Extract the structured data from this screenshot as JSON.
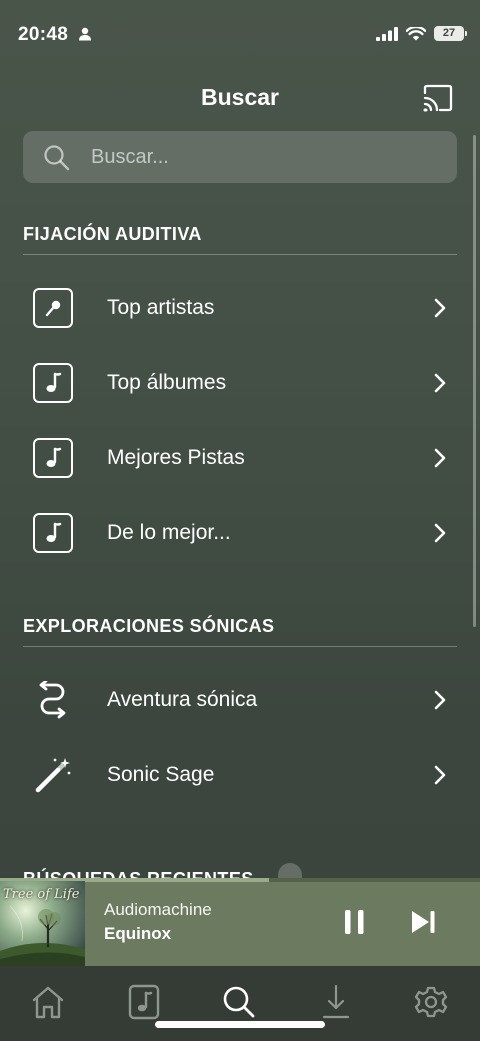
{
  "status_bar": {
    "time": "20:48",
    "battery": "27"
  },
  "header": {
    "title": "Buscar"
  },
  "search": {
    "placeholder": "Buscar..."
  },
  "sections": {
    "fijacion": {
      "title": "FIJACIÓN AUDITIVA",
      "items": [
        {
          "label": "Top artistas",
          "icon": "microphone-icon"
        },
        {
          "label": "Top álbumes",
          "icon": "music-note-icon"
        },
        {
          "label": "Mejores Pistas",
          "icon": "music-note-icon"
        },
        {
          "label": "De lo mejor...",
          "icon": "music-note-icon"
        }
      ]
    },
    "exploraciones": {
      "title": "EXPLORACIONES SÓNICAS",
      "items": [
        {
          "label": "Aventura sónica",
          "icon": "route-arrows-icon"
        },
        {
          "label": "Sonic Sage",
          "icon": "magic-wand-icon"
        }
      ]
    },
    "recent": {
      "title": "BÚSQUEDAS RECIENTES"
    }
  },
  "player": {
    "artist": "Audiomachine",
    "track": "Equinox",
    "album_text": "Tree of Life",
    "progress": 0.56
  },
  "tabs": [
    {
      "name": "home",
      "icon": "home-icon"
    },
    {
      "name": "library",
      "icon": "music-note-icon"
    },
    {
      "name": "search",
      "icon": "search-icon",
      "active": true
    },
    {
      "name": "downloads",
      "icon": "download-icon"
    },
    {
      "name": "settings",
      "icon": "gear-icon"
    }
  ],
  "colors": {
    "background": "#445046",
    "player": "#6c7a5f",
    "tab_bar": "#353c36"
  }
}
